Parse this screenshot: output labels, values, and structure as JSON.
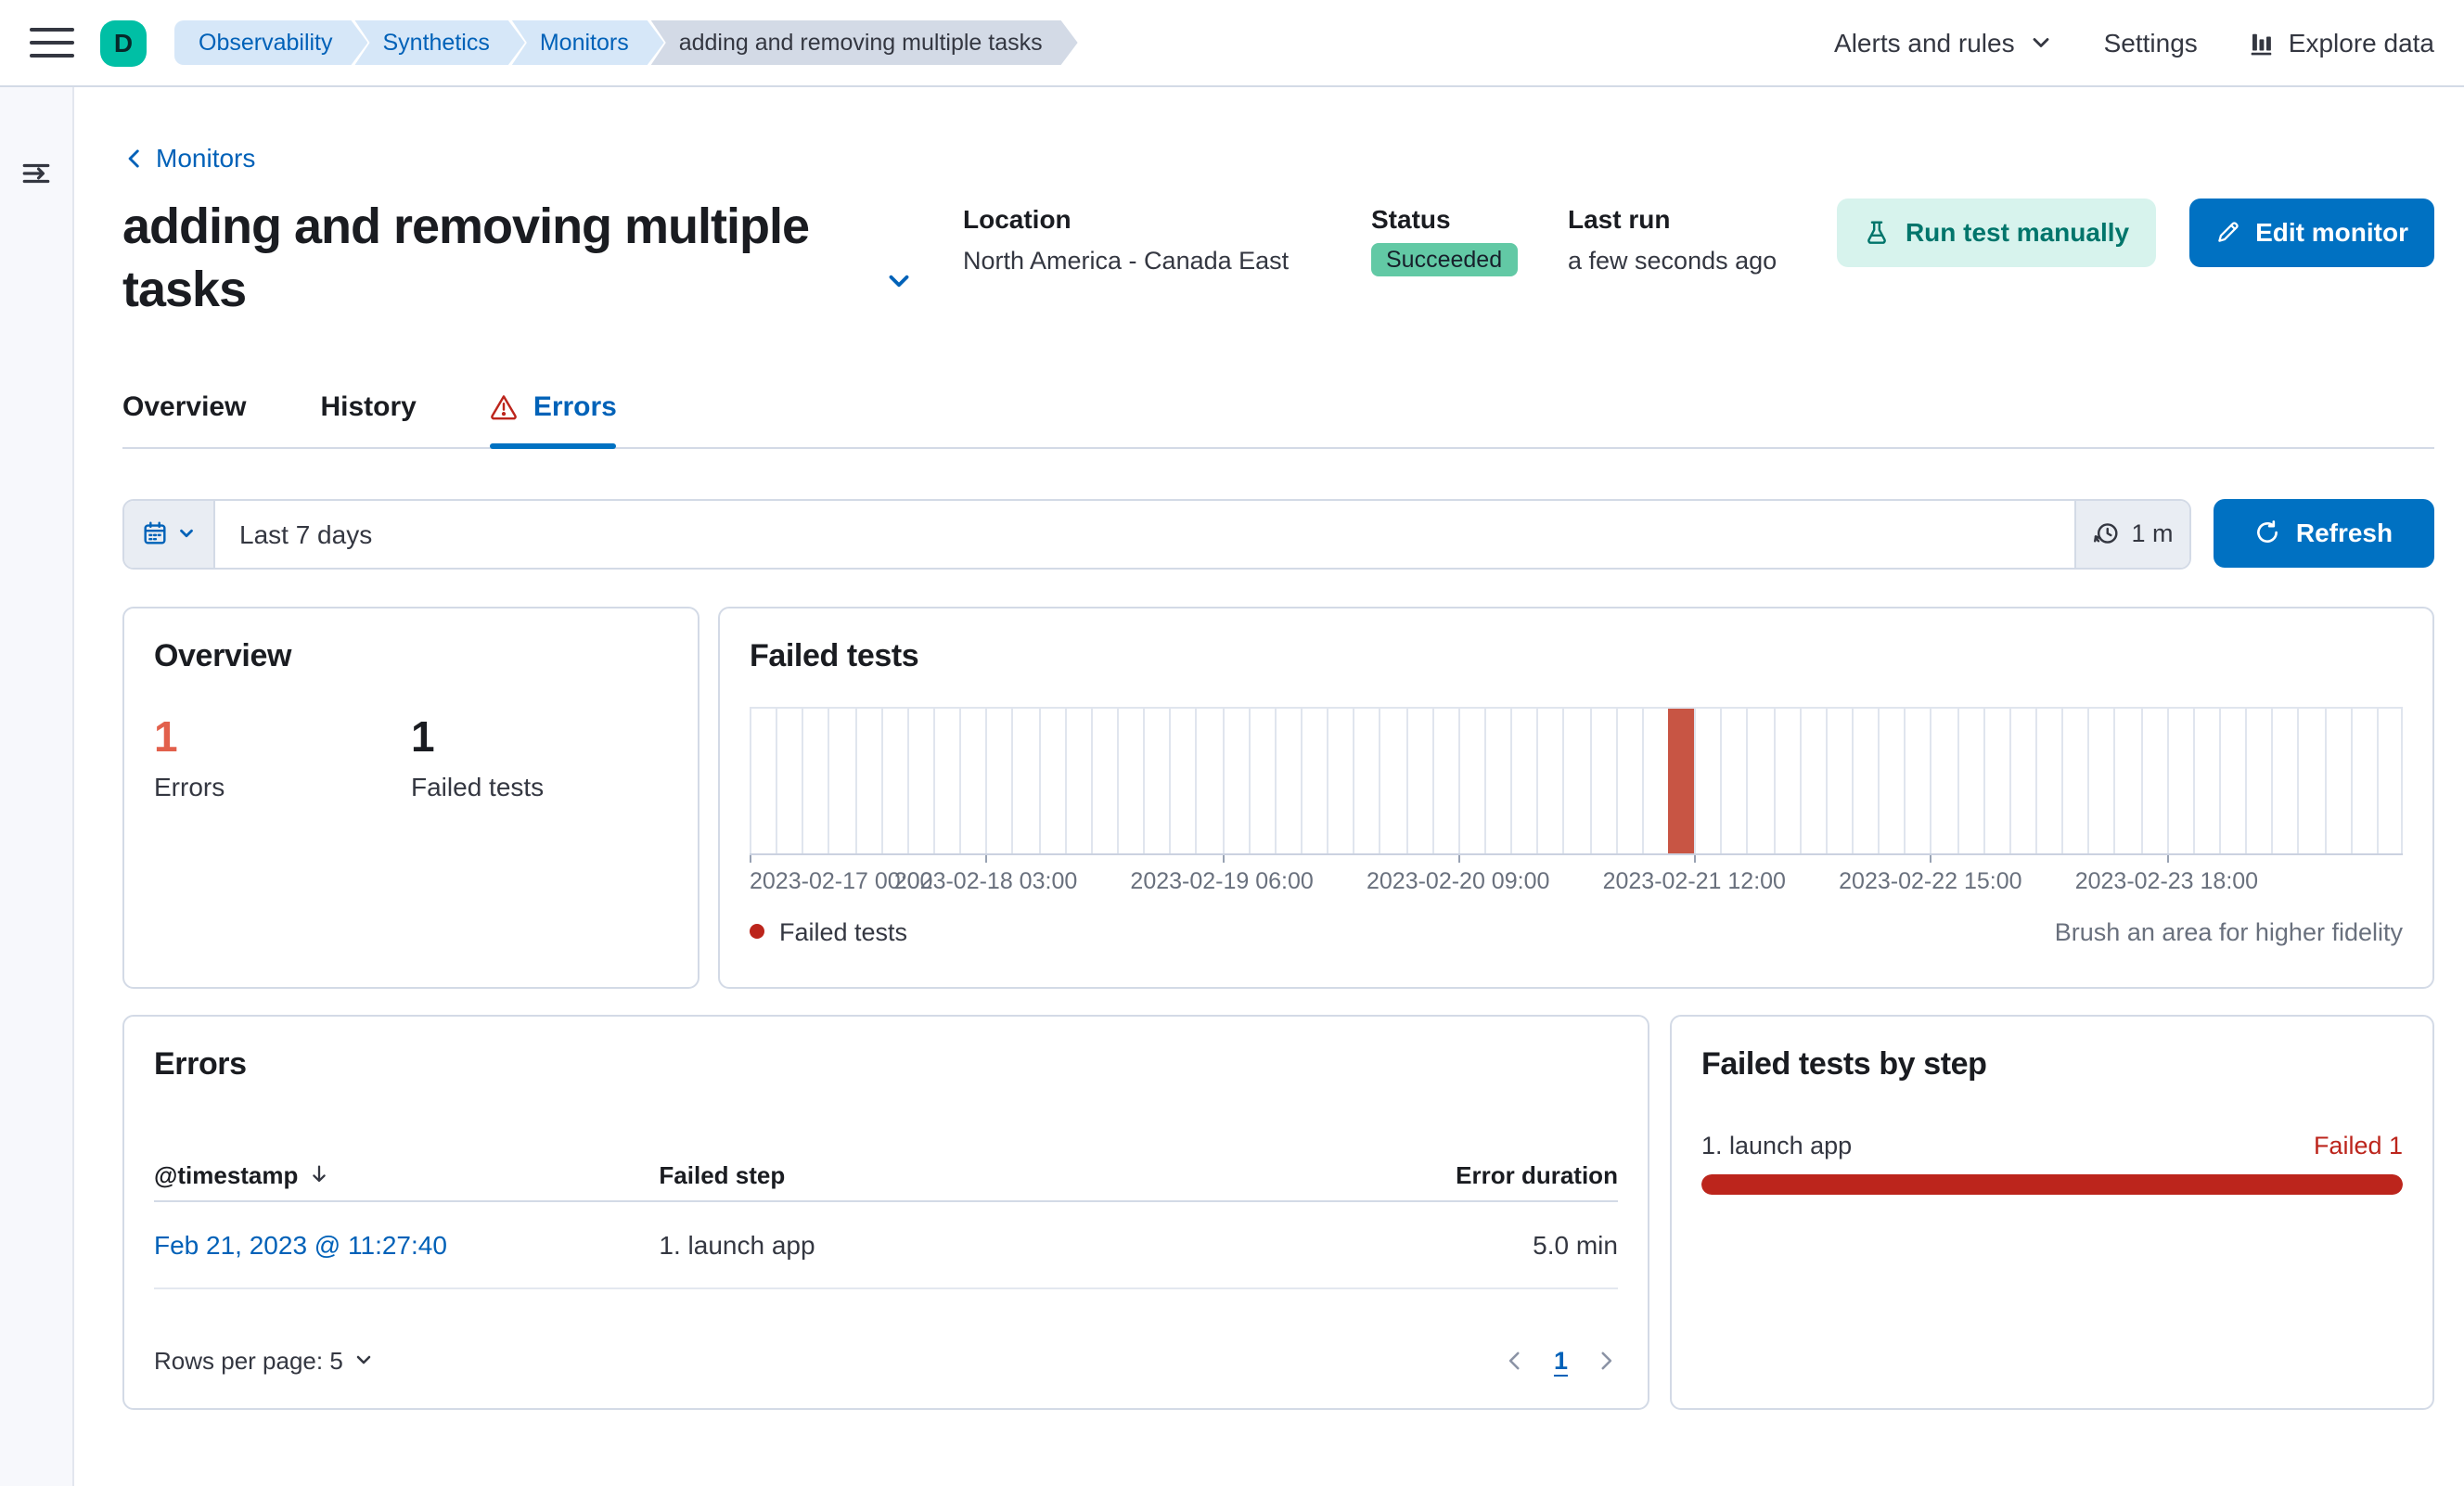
{
  "header": {
    "avatar_initial": "D",
    "breadcrumbs": [
      "Observability",
      "Synthetics",
      "Monitors",
      "adding and removing multiple tasks"
    ],
    "nav_right": {
      "alerts": "Alerts and rules",
      "settings": "Settings",
      "explore": "Explore data"
    }
  },
  "page": {
    "back_link": "Monitors",
    "title": "adding and removing multiple tasks",
    "meta": {
      "location_label": "Location",
      "location_value": "North America - Canada East",
      "status_label": "Status",
      "status_value": "Succeeded",
      "last_run_label": "Last run",
      "last_run_value": "a few seconds ago"
    },
    "actions": {
      "run_test": "Run test manually",
      "edit_monitor": "Edit monitor"
    }
  },
  "tabs": [
    {
      "label": "Overview",
      "active": false
    },
    {
      "label": "History",
      "active": false
    },
    {
      "label": "Errors",
      "active": true,
      "icon": "alert-icon"
    }
  ],
  "filter_bar": {
    "date_range": "Last 7 days",
    "refresh_interval": "1 m",
    "refresh_label": "Refresh"
  },
  "overview_panel": {
    "title": "Overview",
    "errors_count": "1",
    "errors_label": "Errors",
    "failed_count": "1",
    "failed_label": "Failed tests"
  },
  "failed_tests_panel": {
    "title": "Failed tests",
    "legend_label": "Failed tests",
    "brush_hint": "Brush an area for higher fidelity",
    "chart_data": {
      "type": "bar",
      "title": "Failed tests",
      "x_axis": {
        "start": "2023-02-17 00:00",
        "end": "2023-02-24 21:00",
        "bucket_hours": 3,
        "tick_interval_hours": 27,
        "tick_labels": [
          "2023-02-17 00:00",
          "2023-02-18 03:00",
          "2023-02-19 06:00",
          "2023-02-20 09:00",
          "2023-02-21 12:00",
          "2023-02-22 15:00",
          "2023-02-23 18:00"
        ]
      },
      "y_axis": {
        "min": 0,
        "max": 1,
        "labels_visible": false
      },
      "grid": "vertical-only",
      "legend": {
        "position": "bottom-left",
        "entries": [
          "Failed tests"
        ]
      },
      "series": [
        {
          "name": "Failed tests",
          "color": "#C85544",
          "points": [
            {
              "x": "2023-02-21 09:00",
              "y": 1
            }
          ]
        }
      ]
    }
  },
  "errors_panel": {
    "title": "Errors",
    "columns": [
      "@timestamp",
      "Failed step",
      "Error duration"
    ],
    "sort": {
      "column": "@timestamp",
      "direction": "desc"
    },
    "rows": [
      {
        "timestamp": "Feb 21, 2023 @ 11:27:40",
        "failed_step": "1. launch app",
        "error_duration": "5.0 min"
      }
    ],
    "rows_per_page": "Rows per page: 5",
    "page": "1"
  },
  "failed_by_step_panel": {
    "title": "Failed tests by step",
    "steps": [
      {
        "label": "1. launch app",
        "status": "Failed 1",
        "value": 1,
        "max": 1
      }
    ]
  },
  "icons": [
    "hamburger-menu-icon",
    "chevron-down-icon",
    "bar-chart-icon",
    "expand-menu-icon",
    "chevron-left-icon",
    "beaker-icon",
    "pencil-icon",
    "alert-icon",
    "calendar-icon",
    "timer-icon",
    "refresh-icon",
    "sort-desc-icon",
    "chevron-right-icon",
    "legend-dot"
  ],
  "colors": {
    "primary_button": "#0071C2",
    "link": "#0061B8",
    "danger": "#BC251C",
    "errors_count": "#E2604C",
    "chart_bar": "#C85544",
    "success_badge": "#62C9A5",
    "avatar_teal": "#00BFA5",
    "run_test_bg": "#D7F3ED",
    "run_test_text": "#00756B",
    "panel_border": "#D3DAE6",
    "subdued_text": "#69707D"
  }
}
